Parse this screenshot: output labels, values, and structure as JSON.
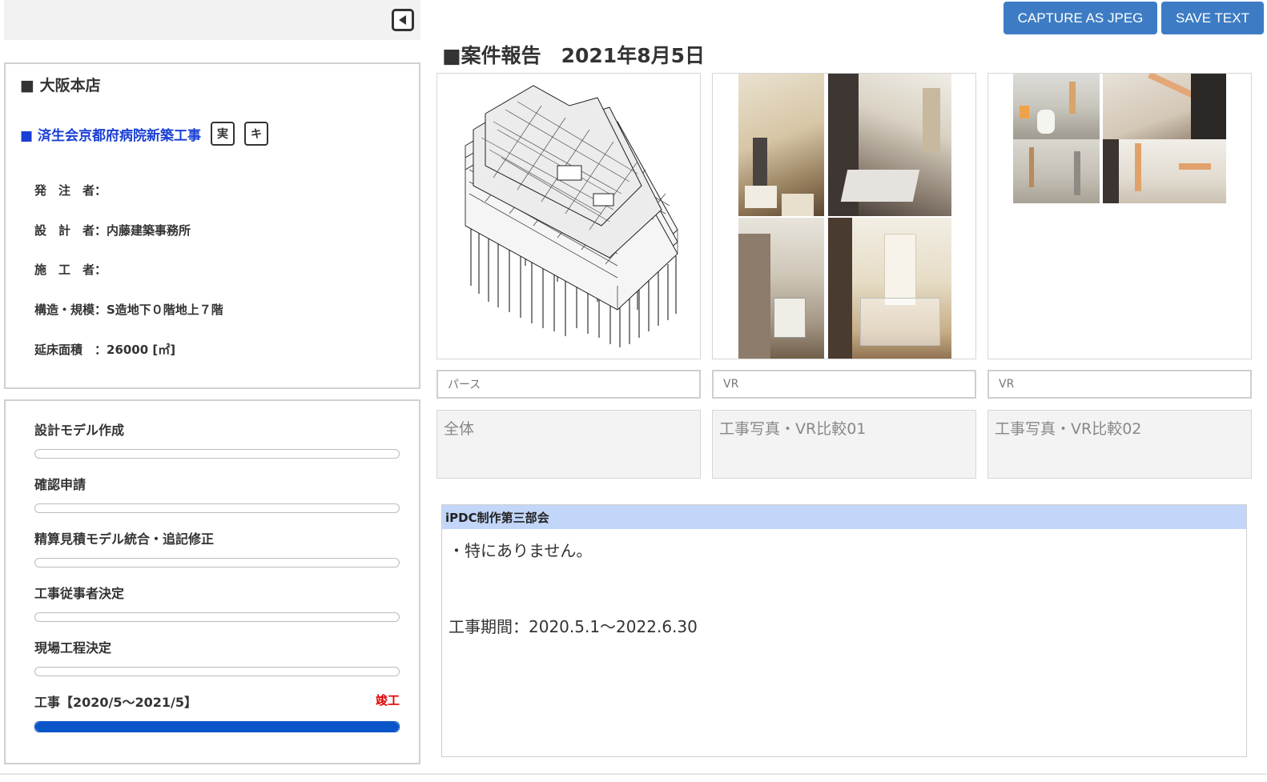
{
  "toolbar": {
    "capture_label": "CAPTURE AS JPEG",
    "save_label": "SAVE TEXT"
  },
  "info": {
    "office": "■ 大阪本店",
    "project_name": "■ 済生会京都府病院新築工事",
    "tags": [
      "実",
      "キ"
    ],
    "rows": [
      "発　注　者：",
      "設　計　者：内藤建築事務所",
      "施　工　者：",
      "構造・規模：S造地下０階地上７階",
      "延床面積　：26000 [㎡]"
    ]
  },
  "progress": {
    "steps": [
      {
        "title": "設計モデル作成",
        "status": "",
        "fill": 0
      },
      {
        "title": "確認申請",
        "status": "",
        "fill": 0
      },
      {
        "title": "精算見積モデル統合・追記修正",
        "status": "",
        "fill": 0
      },
      {
        "title": "工事従事者決定",
        "status": "",
        "fill": 0
      },
      {
        "title": "現場工程決定",
        "status": "",
        "fill": 0
      },
      {
        "title": "工事【2020/5～2021/5】",
        "status": "竣工",
        "fill": 1
      }
    ],
    "accent_color": "#0a55c8"
  },
  "report": {
    "title": "■案件報告　2021年8月5日",
    "cards": [
      {
        "caption": "パース",
        "description": "全体"
      },
      {
        "caption": "VR",
        "description": "工事写真・VR比較01"
      },
      {
        "caption": "VR",
        "description": "工事写真・VR比較02"
      }
    ]
  },
  "comment": {
    "header": "iPDC制作第三部会",
    "line1": "・特にありません。",
    "line2": "工事期間：2020.5.1～2022.6.30"
  }
}
